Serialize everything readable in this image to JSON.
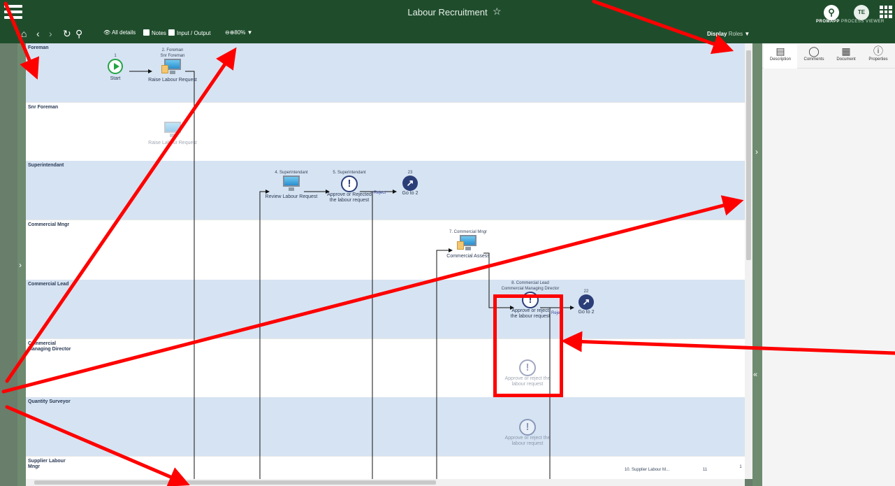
{
  "app": {
    "title": "Labour Recruitment",
    "star": "☆",
    "brand_main": "PROMAPP",
    "brand_sub": "PROCESS VIEWER",
    "user_initials": "TE"
  },
  "toolbar": {
    "all_details": "All details",
    "notes": "Notes",
    "input_output": "Input / Output",
    "zoom": "80%",
    "display_label": "Display",
    "display_value": "Roles"
  },
  "lanes": [
    {
      "label": "Foreman"
    },
    {
      "label": "Snr Foreman"
    },
    {
      "label": "Superintendant"
    },
    {
      "label": "Commercial Mngr"
    },
    {
      "label": "Commercial Lead"
    },
    {
      "label": "Commercial Managing Director"
    },
    {
      "label": "Quantity Surveyor"
    },
    {
      "label": "Supplier Labour Mngr"
    }
  ],
  "nodes": {
    "start": {
      "num": "1",
      "caption": "Start"
    },
    "raise": {
      "head1": "2. Foreman",
      "head2": "Snr Foreman",
      "caption": "Raise Labour Request"
    },
    "raise_ghost": {
      "caption": "Raise Labour Request"
    },
    "review": {
      "head": "4. Superintendant",
      "caption": "Review Labour Request"
    },
    "approve5": {
      "head": "5. Superintendant",
      "caption1": "Approve or Rejected",
      "caption2": "the labour request",
      "branch": "Reject"
    },
    "goto23": {
      "num": "23",
      "caption": "Go to 2"
    },
    "commercial7": {
      "head": "7. Commercial Mngr",
      "caption": "Commercial Assess"
    },
    "approve8": {
      "head1": "8. Commercial Lead",
      "head2": "Commercial Managing Director",
      "caption1": "Approve or reject",
      "caption2": "the labour request",
      "branch": "Reject"
    },
    "goto22": {
      "num": "22",
      "caption": "Go to 2"
    },
    "approve_cmd": {
      "caption1": "Approve or reject the",
      "caption2": "labour request"
    },
    "approve_qs": {
      "caption1": "Approve or reject the",
      "caption2": "labour request"
    },
    "supplier10": {
      "head": "10. Supplier Labour M..."
    },
    "node11": {
      "num": "11"
    },
    "node_edge": {
      "num": "1"
    }
  },
  "panel_tabs": [
    {
      "label": "Description",
      "icon": "description-icon"
    },
    {
      "label": "Comments",
      "icon": "comments-icon"
    },
    {
      "label": "Document",
      "icon": "document-icon"
    },
    {
      "label": "Properties",
      "icon": "info-icon"
    }
  ],
  "colors": {
    "header": "#1f4d2c",
    "lane_blue": "#d6e3f2",
    "annotation": "#ff0000",
    "start_green": "#23a446",
    "decision_navy": "#2c3e78"
  }
}
